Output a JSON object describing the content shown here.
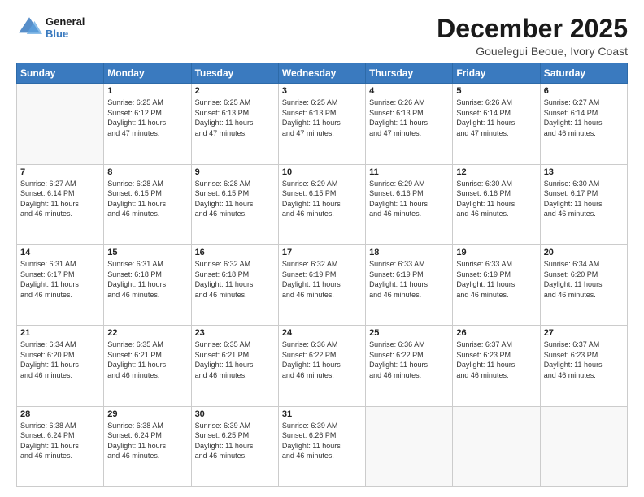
{
  "logo": {
    "line1": "General",
    "line2": "Blue"
  },
  "title": "December 2025",
  "subtitle": "Gouelegui Beoue, Ivory Coast",
  "days_header": [
    "Sunday",
    "Monday",
    "Tuesday",
    "Wednesday",
    "Thursday",
    "Friday",
    "Saturday"
  ],
  "weeks": [
    [
      {
        "day": "",
        "info": ""
      },
      {
        "day": "1",
        "info": "Sunrise: 6:25 AM\nSunset: 6:12 PM\nDaylight: 11 hours\nand 47 minutes."
      },
      {
        "day": "2",
        "info": "Sunrise: 6:25 AM\nSunset: 6:13 PM\nDaylight: 11 hours\nand 47 minutes."
      },
      {
        "day": "3",
        "info": "Sunrise: 6:25 AM\nSunset: 6:13 PM\nDaylight: 11 hours\nand 47 minutes."
      },
      {
        "day": "4",
        "info": "Sunrise: 6:26 AM\nSunset: 6:13 PM\nDaylight: 11 hours\nand 47 minutes."
      },
      {
        "day": "5",
        "info": "Sunrise: 6:26 AM\nSunset: 6:14 PM\nDaylight: 11 hours\nand 47 minutes."
      },
      {
        "day": "6",
        "info": "Sunrise: 6:27 AM\nSunset: 6:14 PM\nDaylight: 11 hours\nand 46 minutes."
      }
    ],
    [
      {
        "day": "7",
        "info": "Sunrise: 6:27 AM\nSunset: 6:14 PM\nDaylight: 11 hours\nand 46 minutes."
      },
      {
        "day": "8",
        "info": "Sunrise: 6:28 AM\nSunset: 6:15 PM\nDaylight: 11 hours\nand 46 minutes."
      },
      {
        "day": "9",
        "info": "Sunrise: 6:28 AM\nSunset: 6:15 PM\nDaylight: 11 hours\nand 46 minutes."
      },
      {
        "day": "10",
        "info": "Sunrise: 6:29 AM\nSunset: 6:15 PM\nDaylight: 11 hours\nand 46 minutes."
      },
      {
        "day": "11",
        "info": "Sunrise: 6:29 AM\nSunset: 6:16 PM\nDaylight: 11 hours\nand 46 minutes."
      },
      {
        "day": "12",
        "info": "Sunrise: 6:30 AM\nSunset: 6:16 PM\nDaylight: 11 hours\nand 46 minutes."
      },
      {
        "day": "13",
        "info": "Sunrise: 6:30 AM\nSunset: 6:17 PM\nDaylight: 11 hours\nand 46 minutes."
      }
    ],
    [
      {
        "day": "14",
        "info": "Sunrise: 6:31 AM\nSunset: 6:17 PM\nDaylight: 11 hours\nand 46 minutes."
      },
      {
        "day": "15",
        "info": "Sunrise: 6:31 AM\nSunset: 6:18 PM\nDaylight: 11 hours\nand 46 minutes."
      },
      {
        "day": "16",
        "info": "Sunrise: 6:32 AM\nSunset: 6:18 PM\nDaylight: 11 hours\nand 46 minutes."
      },
      {
        "day": "17",
        "info": "Sunrise: 6:32 AM\nSunset: 6:19 PM\nDaylight: 11 hours\nand 46 minutes."
      },
      {
        "day": "18",
        "info": "Sunrise: 6:33 AM\nSunset: 6:19 PM\nDaylight: 11 hours\nand 46 minutes."
      },
      {
        "day": "19",
        "info": "Sunrise: 6:33 AM\nSunset: 6:19 PM\nDaylight: 11 hours\nand 46 minutes."
      },
      {
        "day": "20",
        "info": "Sunrise: 6:34 AM\nSunset: 6:20 PM\nDaylight: 11 hours\nand 46 minutes."
      }
    ],
    [
      {
        "day": "21",
        "info": "Sunrise: 6:34 AM\nSunset: 6:20 PM\nDaylight: 11 hours\nand 46 minutes."
      },
      {
        "day": "22",
        "info": "Sunrise: 6:35 AM\nSunset: 6:21 PM\nDaylight: 11 hours\nand 46 minutes."
      },
      {
        "day": "23",
        "info": "Sunrise: 6:35 AM\nSunset: 6:21 PM\nDaylight: 11 hours\nand 46 minutes."
      },
      {
        "day": "24",
        "info": "Sunrise: 6:36 AM\nSunset: 6:22 PM\nDaylight: 11 hours\nand 46 minutes."
      },
      {
        "day": "25",
        "info": "Sunrise: 6:36 AM\nSunset: 6:22 PM\nDaylight: 11 hours\nand 46 minutes."
      },
      {
        "day": "26",
        "info": "Sunrise: 6:37 AM\nSunset: 6:23 PM\nDaylight: 11 hours\nand 46 minutes."
      },
      {
        "day": "27",
        "info": "Sunrise: 6:37 AM\nSunset: 6:23 PM\nDaylight: 11 hours\nand 46 minutes."
      }
    ],
    [
      {
        "day": "28",
        "info": "Sunrise: 6:38 AM\nSunset: 6:24 PM\nDaylight: 11 hours\nand 46 minutes."
      },
      {
        "day": "29",
        "info": "Sunrise: 6:38 AM\nSunset: 6:24 PM\nDaylight: 11 hours\nand 46 minutes."
      },
      {
        "day": "30",
        "info": "Sunrise: 6:39 AM\nSunset: 6:25 PM\nDaylight: 11 hours\nand 46 minutes."
      },
      {
        "day": "31",
        "info": "Sunrise: 6:39 AM\nSunset: 6:26 PM\nDaylight: 11 hours\nand 46 minutes."
      },
      {
        "day": "",
        "info": ""
      },
      {
        "day": "",
        "info": ""
      },
      {
        "day": "",
        "info": ""
      }
    ]
  ]
}
